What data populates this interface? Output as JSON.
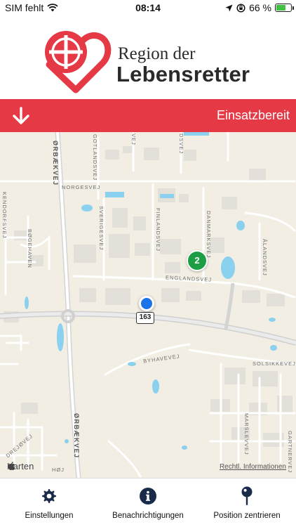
{
  "status_bar": {
    "carrier": "SIM fehlt",
    "time": "08:14",
    "battery_percent": "66 %",
    "battery_level": 0.66
  },
  "header": {
    "logo_line1": "Region der",
    "logo_line2": "Lebensretter",
    "logo_color": "#e63946"
  },
  "status_band": {
    "text": "Einsatzbereit",
    "background": "#e63946"
  },
  "map": {
    "roads": {
      "orbaekvej_top": "ØRBÆKVEJ",
      "orbaekvej_bottom": "ØRBÆKVEJ",
      "norgesvej": "NORGESVEJ",
      "gotlandsvej": "GOTLANDSVEJ",
      "sverigesvej": "SVERIGESVEJ",
      "finlandsvej": "FINLANDSVEJ",
      "danmarksvej": "DANMARKSVEJ",
      "alandsvej": "ÅLANDSVEJ",
      "englandsvej": "ENGLANDSVEJ",
      "byhavevej": "BYHAVEVEJ",
      "solsikkevej": "SOLSIKKEVEJ",
      "marslevvej": "MARSLEVVEJ",
      "gartnervej": "GARTNERVEJ",
      "bogehaven": "BØGEHAVEN",
      "kendorfsvej": "KENDORFSVEJ",
      "drejovej": "DREJØVEJ",
      "hoj": "HØJ",
      "vej_top": "VEJ",
      "dsvej": "DSVEJ"
    },
    "route_number": "163",
    "cluster_count": "2",
    "attribution": "Karten",
    "legal_link": "Rechtl. Informationen"
  },
  "tabs": [
    {
      "label": "Einstellungen",
      "icon": "gear-icon"
    },
    {
      "label": "Benachrichtigungen",
      "icon": "info-icon"
    },
    {
      "label": "Position zentrieren",
      "icon": "location-pin-icon"
    }
  ]
}
